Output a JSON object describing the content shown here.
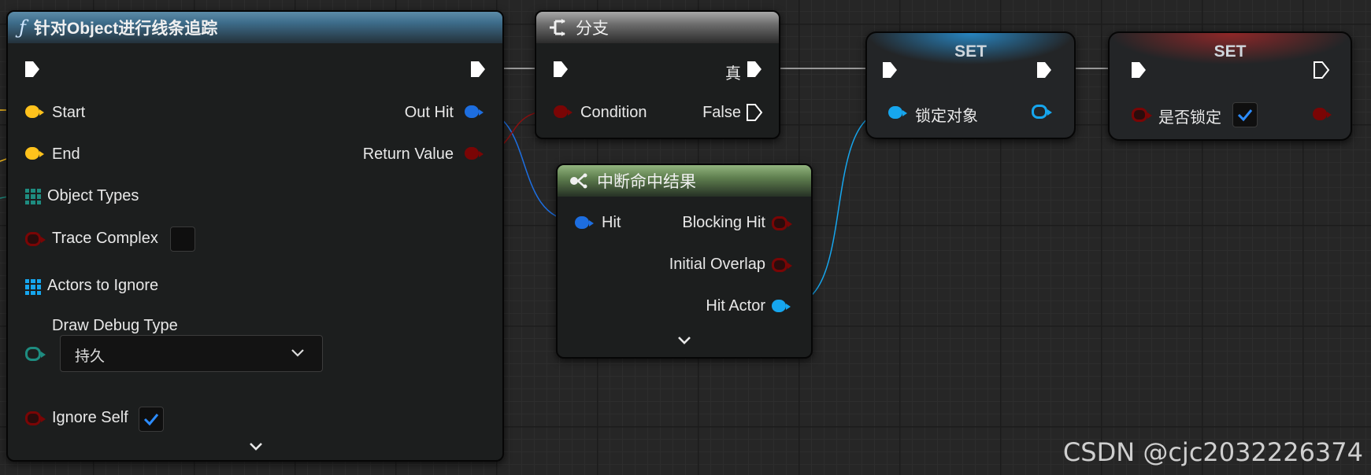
{
  "nodes": {
    "line_trace": {
      "title": "针对Object进行线条追踪",
      "icon": "function-icon",
      "inputs": {
        "start": "Start",
        "end": "End",
        "object_types": "Object Types",
        "trace_complex": "Trace Complex",
        "actors_to_ignore": "Actors to Ignore",
        "draw_debug_type": "Draw Debug Type",
        "draw_debug_value": "持久",
        "ignore_self": "Ignore Self"
      },
      "outputs": {
        "out_hit": "Out Hit",
        "return_value": "Return Value"
      },
      "trace_complex_checked": false,
      "ignore_self_checked": true
    },
    "branch": {
      "title": "分支",
      "icon": "branch-icon",
      "condition": "Condition",
      "true_label": "真",
      "false_label": "False"
    },
    "break_hit": {
      "title": "中断命中结果",
      "icon": "break-struct-icon",
      "hit": "Hit",
      "blocking_hit": "Blocking Hit",
      "initial_overlap": "Initial Overlap",
      "hit_actor": "Hit Actor"
    },
    "set_target": {
      "title": "SET",
      "variable": "锁定对象"
    },
    "set_locked": {
      "title": "SET",
      "variable": "是否锁定",
      "checked": true
    }
  },
  "colors": {
    "exec": "#ffffff",
    "vector_pin": "#ffc21c",
    "struct_pin": "#1d6ee0",
    "object_pin": "#16a6ee",
    "bool_pin": "#7a0505",
    "check_accent": "#2c8cff"
  },
  "watermark": "CSDN @cjc2032226374"
}
